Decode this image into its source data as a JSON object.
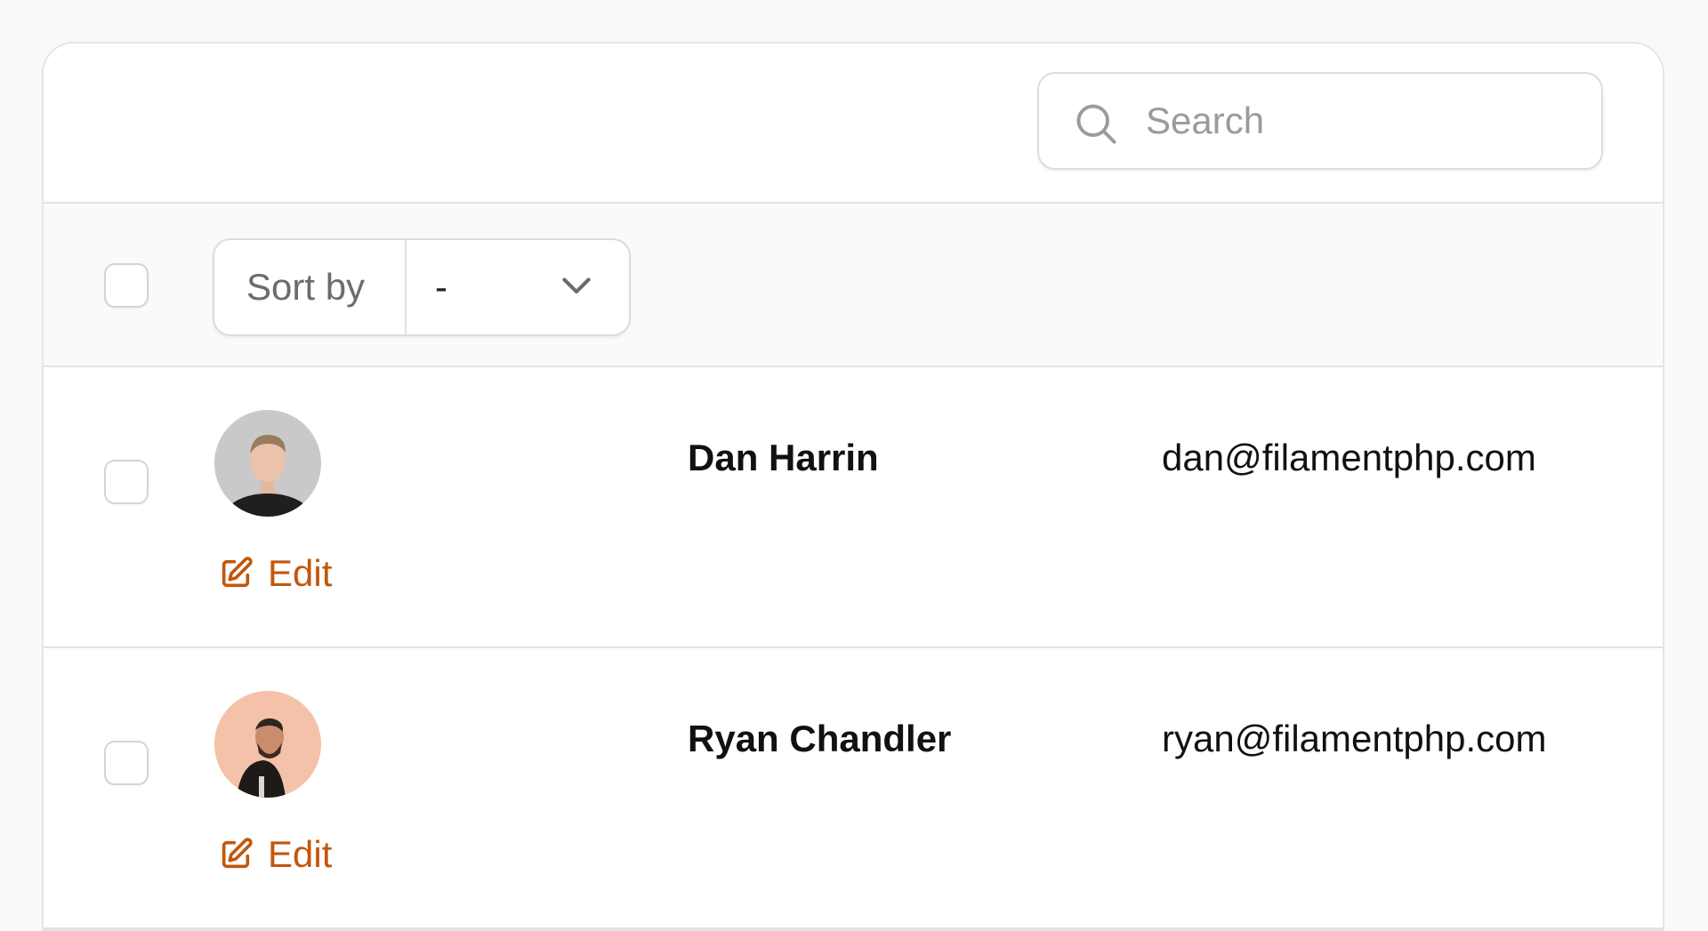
{
  "search": {
    "placeholder": "Search",
    "value": ""
  },
  "header": {
    "sort_label": "Sort by",
    "sort_value": "-"
  },
  "rows": [
    {
      "name": "Dan Harrin",
      "email": "dan@filamentphp.com",
      "edit_label": "Edit"
    },
    {
      "name": "Ryan Chandler",
      "email": "ryan@filamentphp.com",
      "edit_label": "Edit"
    }
  ],
  "colors": {
    "accent": "#c2570c",
    "border": "#e3e3e3",
    "background": "#f9f9f9"
  },
  "icons": {
    "search": "search-icon",
    "sort_toggle": "chevron-down-icon",
    "edit": "edit-icon"
  }
}
